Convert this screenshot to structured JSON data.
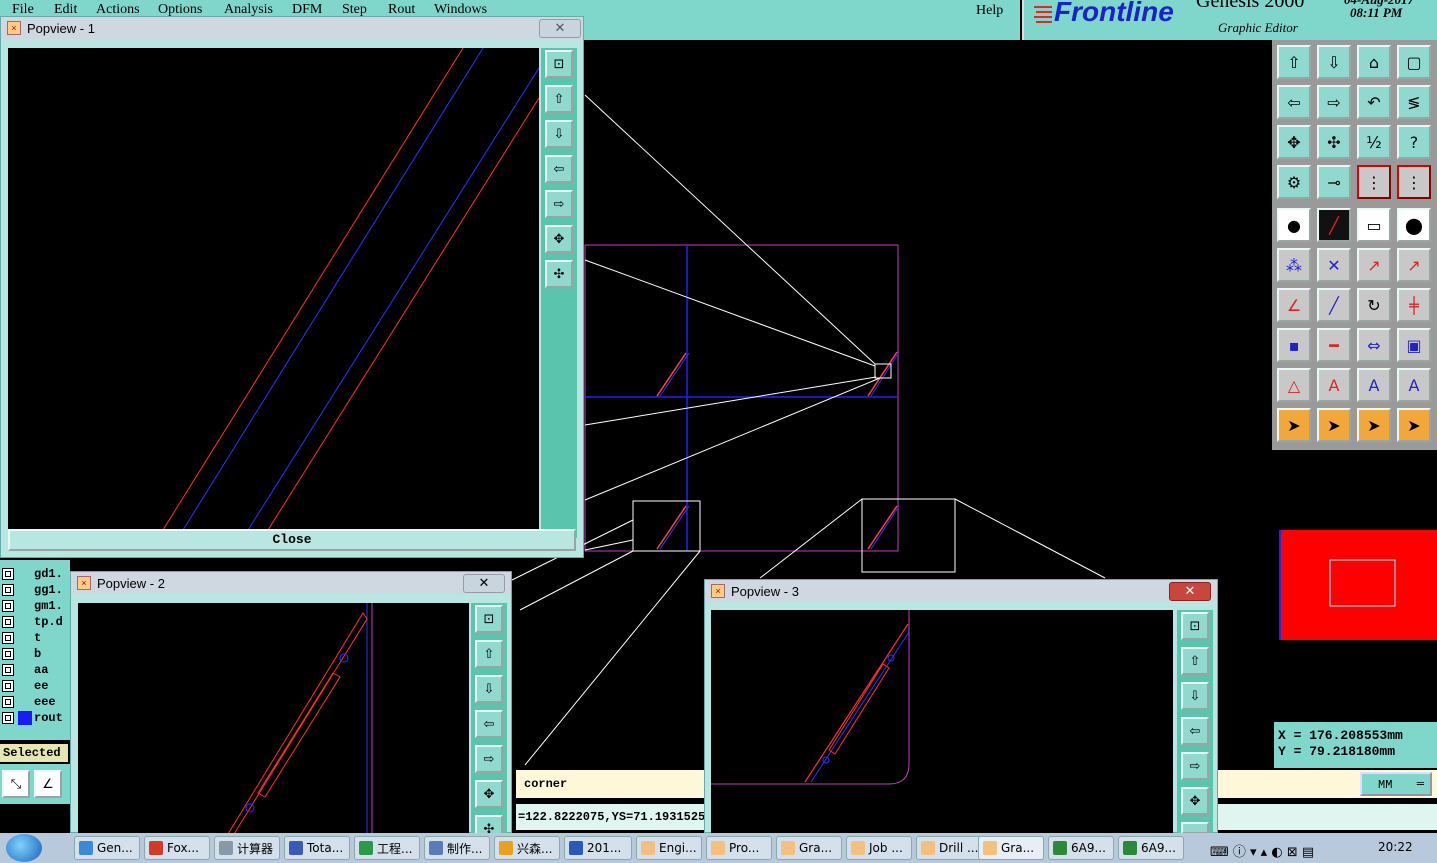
{
  "menubar": {
    "items": [
      "File",
      "Edit",
      "Actions",
      "Options",
      "Analysis",
      "DFM",
      "Step",
      "Rout",
      "Windows"
    ],
    "help": "Help"
  },
  "brand": {
    "logo": "Frontline",
    "product": "Genesis 2000",
    "subtitle": "Graphic Editor",
    "date": "04-Aug-2017",
    "time": "08:11 PM"
  },
  "popups": [
    {
      "title": "Popview - 1",
      "close_label": "Close"
    },
    {
      "title": "Popview - 2"
    },
    {
      "title": "Popview - 3"
    }
  ],
  "layers": [
    "gd1.",
    "gg1.",
    "gm1.",
    "tp.d",
    "t",
    "b",
    "aa",
    "ee",
    "eee",
    "rout"
  ],
  "selected_label": "Selected",
  "message": "corner",
  "status_text": "=122.8222075,YS=71.1931525,",
  "coords": {
    "x": "X = 176.208553mm",
    "y": "Y = 79.218180mm"
  },
  "unit": "MM",
  "taskbar": {
    "items": [
      "Gen...",
      "Fox...",
      "计算器",
      "Tota...",
      "工程...",
      "制作...",
      "兴森...",
      "201...",
      "Engi...",
      "Pro...",
      "Gra...",
      "Job ...",
      "Drill ...",
      "Gra...",
      "6A9...",
      "6A9..."
    ],
    "clock": "20:22"
  },
  "colors": {
    "teal": "#7fd6cb",
    "red_layer": "#ff0000",
    "blue_layer": "#1a1aff",
    "magenta_profile": "#c03fc0"
  }
}
